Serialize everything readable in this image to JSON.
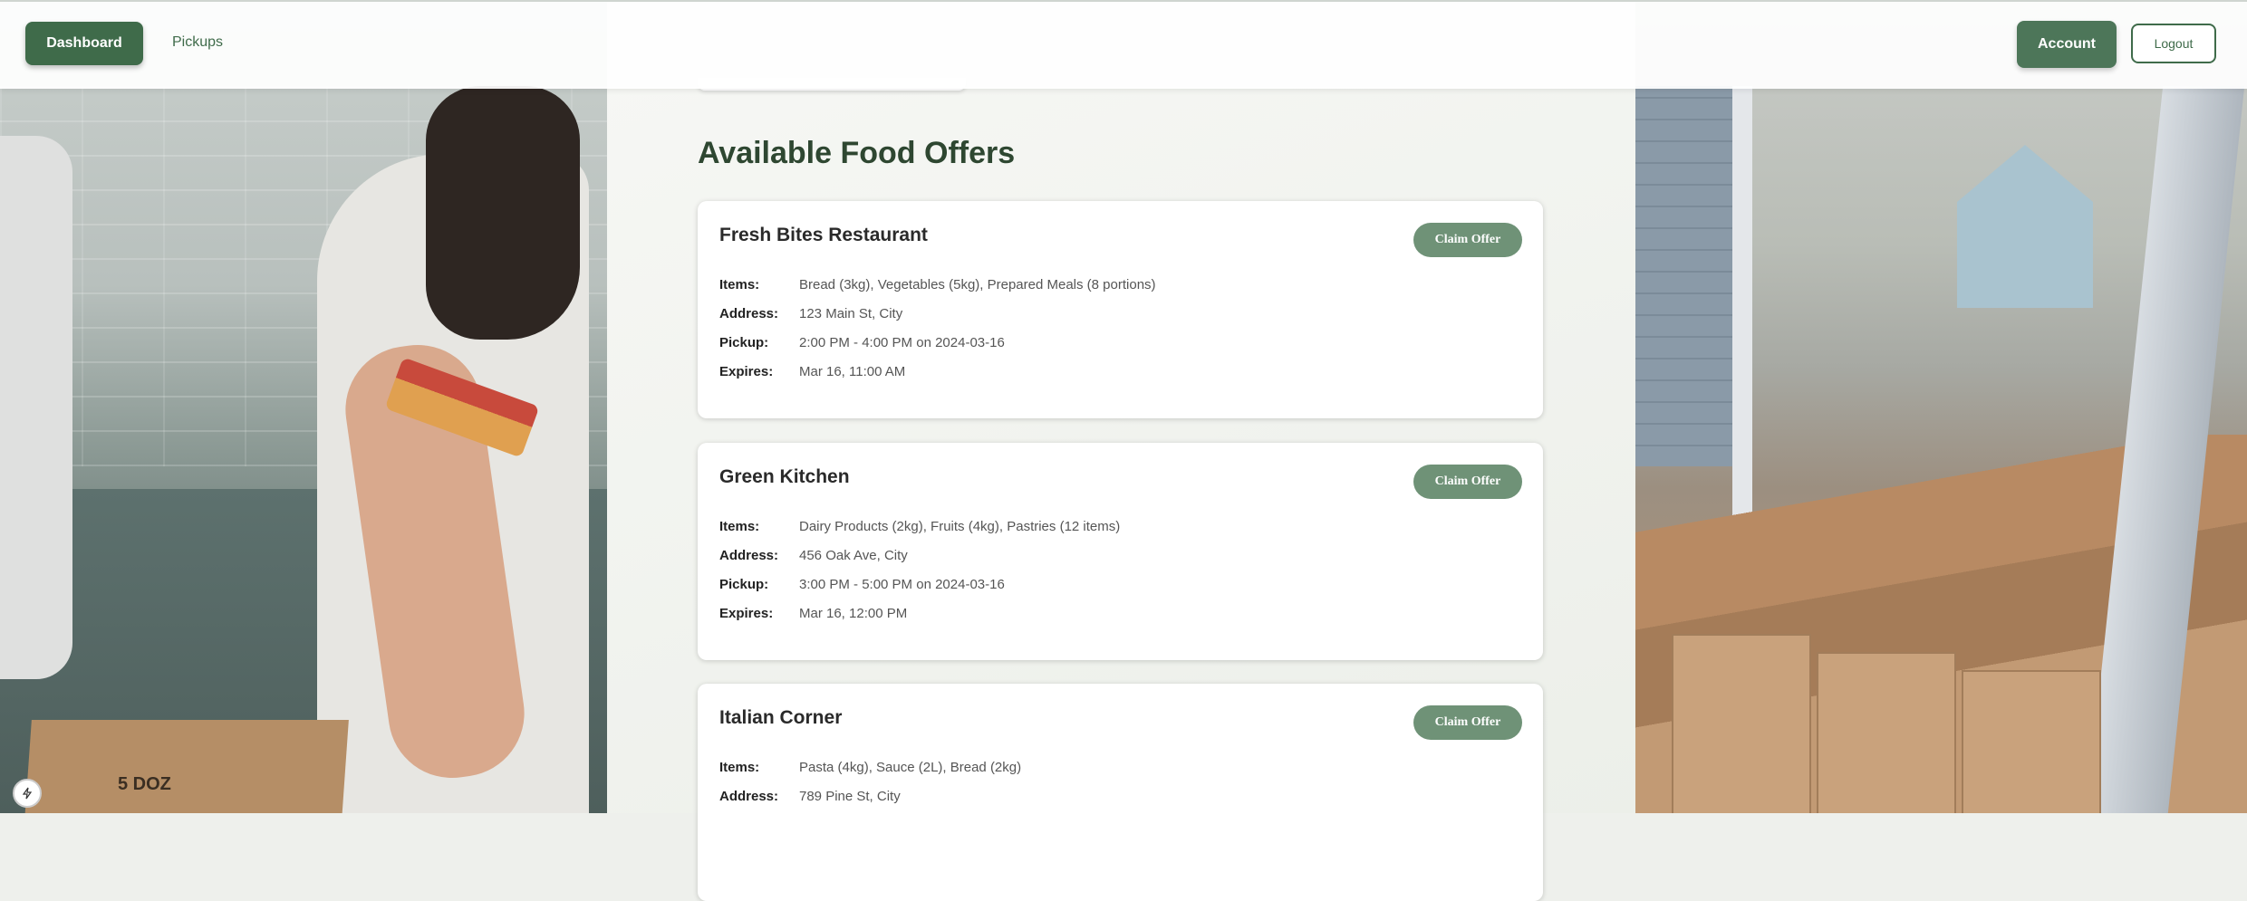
{
  "nav": {
    "dashboard_label": "Dashboard",
    "pickups_label": "Pickups",
    "account_label": "Account",
    "logout_label": "Logout"
  },
  "main": {
    "title": "Available Food Offers",
    "labels": {
      "items": "Items:",
      "address": "Address:",
      "pickup": "Pickup:",
      "expires": "Expires:"
    },
    "offers": [
      {
        "restaurant": "Fresh Bites Restaurant",
        "claim_label": "Claim Offer",
        "items": "Bread (3kg), Vegetables (5kg), Prepared Meals (8 portions)",
        "address": "123 Main St, City",
        "pickup": "2:00 PM - 4:00 PM on 2024-03-16",
        "expires": "Mar 16, 11:00 AM"
      },
      {
        "restaurant": "Green Kitchen",
        "claim_label": "Claim Offer",
        "items": "Dairy Products (2kg), Fruits (4kg), Pastries (12 items)",
        "address": "456 Oak Ave, City",
        "pickup": "3:00 PM - 5:00 PM on 2024-03-16",
        "expires": "Mar 16, 12:00 PM"
      },
      {
        "restaurant": "Italian Corner",
        "claim_label": "Claim Offer",
        "items": "Pasta (4kg), Sauce (2L), Bread (2kg)",
        "address": "789 Pine St, City",
        "pickup": "",
        "expires": ""
      }
    ]
  },
  "background": {
    "box_text": "5 DOZ"
  },
  "colors": {
    "primary": "#3f6b4a",
    "claim_button": "#6f9277",
    "title": "#2e4731"
  },
  "icons": {
    "help": "bolt-icon"
  }
}
